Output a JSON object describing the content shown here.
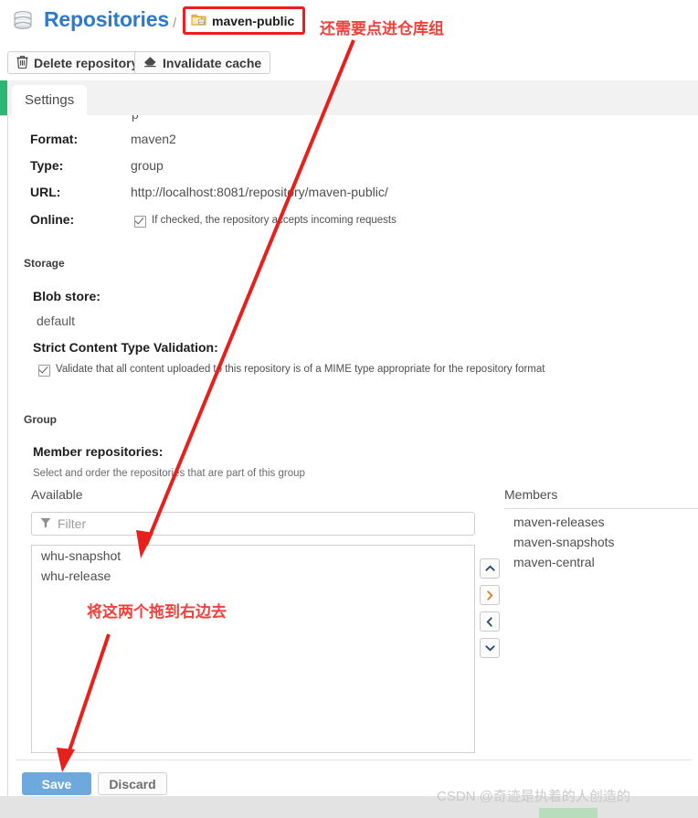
{
  "header": {
    "db_icon": "database-icon",
    "title": "Repositories",
    "separator": "/",
    "current": {
      "icon": "repository-group-icon",
      "label": "maven-public"
    }
  },
  "toolbar": {
    "buttons": [
      {
        "icon": "trash-icon",
        "label": "Delete repository"
      },
      {
        "icon": "eraser-icon",
        "label": "Invalidate cache"
      }
    ]
  },
  "tabs": [
    {
      "label": "Settings",
      "selected": true
    }
  ],
  "settings": {
    "clipped_fragment": "p",
    "fields": [
      {
        "label": "Format:",
        "value": "maven2"
      },
      {
        "label": "Type:",
        "value": "group"
      },
      {
        "label": "URL:",
        "value": "http://localhost:8081/repository/maven-public/"
      }
    ],
    "online": {
      "label": "Online:",
      "checked": true,
      "description": "If checked, the repository accepts incoming requests"
    }
  },
  "storage": {
    "section_title": "Storage",
    "blob_store_label": "Blob store:",
    "blob_store_value": "default",
    "strict_label": "Strict Content Type Validation:",
    "strict_checked": true,
    "strict_description": "Validate that all content uploaded to this repository is of a MIME type appropriate for the repository format"
  },
  "group": {
    "section_title": "Group",
    "member_repositories_label": "Member repositories:",
    "hint": "Select and order the repositories that are part of this group",
    "available_label": "Available",
    "members_label": "Members",
    "filter_placeholder": "Filter",
    "filter_icon": "funnel-icon",
    "available_items": [
      "whu-snapshot",
      "whu-release"
    ],
    "member_items": [
      "maven-releases",
      "maven-snapshots",
      "maven-central"
    ],
    "transfer_buttons": [
      {
        "name": "move-up-button",
        "glyph": "⌃"
      },
      {
        "name": "move-right-button",
        "glyph": "›"
      },
      {
        "name": "move-left-button",
        "glyph": "‹"
      },
      {
        "name": "move-down-button",
        "glyph": "⌄"
      }
    ]
  },
  "footer": {
    "save_label": "Save",
    "discard_label": "Discard"
  },
  "annotations": {
    "top_note": "还需要点进仓库组",
    "drag_note": "将这两个拖到右边去",
    "highlight_color": "#ef1d1d",
    "arrow_color": "#e8201c"
  },
  "watermark": {
    "text": "CSDN @奇迹是执着的人创造的"
  }
}
